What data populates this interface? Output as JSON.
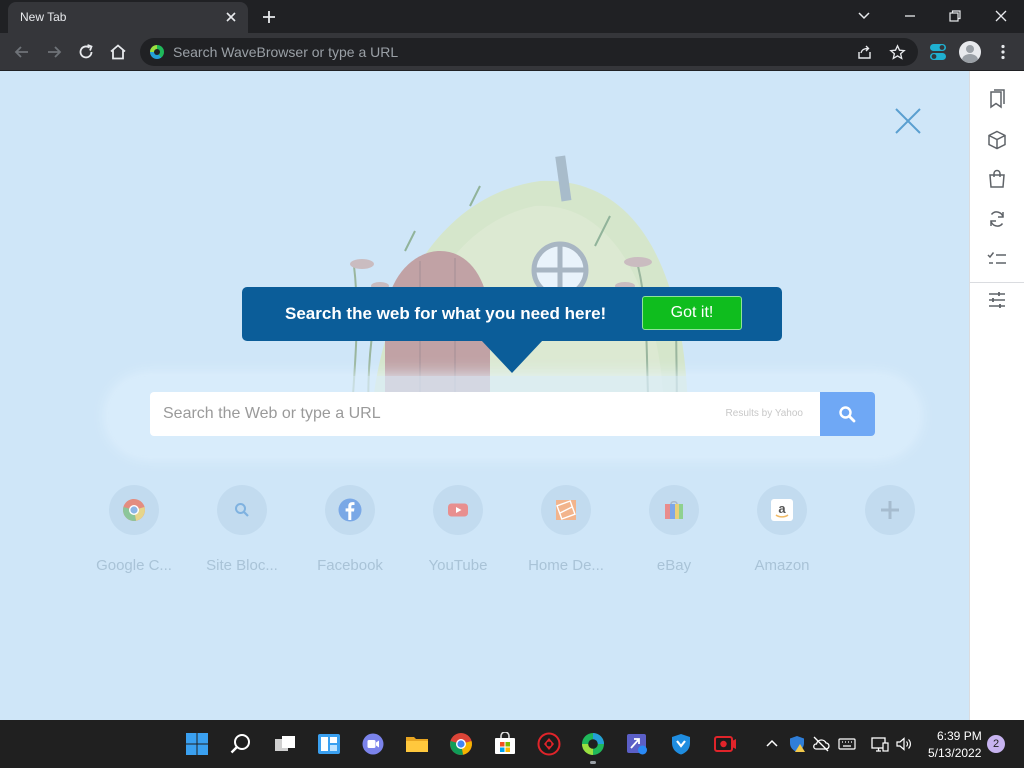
{
  "tab": {
    "title": "New Tab"
  },
  "omnibox": {
    "placeholder": "Search WaveBrowser or type a URL"
  },
  "tooltip": {
    "text": "Search the web for what you need here!",
    "button": "Got it!"
  },
  "search": {
    "placeholder": "Search the Web or type a URL",
    "provider": "Results by Yahoo"
  },
  "tiles": [
    {
      "label": "Google C...",
      "icon": "chrome-icon"
    },
    {
      "label": "Site Bloc...",
      "icon": "search-icon"
    },
    {
      "label": "Facebook",
      "icon": "facebook-icon"
    },
    {
      "label": "YouTube",
      "icon": "youtube-icon"
    },
    {
      "label": "Home De...",
      "icon": "home-depot-icon"
    },
    {
      "label": "eBay",
      "icon": "ebay-icon"
    },
    {
      "label": "Amazon",
      "icon": "amazon-icon"
    },
    {
      "label": "",
      "icon": "add-icon"
    }
  ],
  "taskbar": {
    "time": "6:39 PM",
    "date": "5/13/2022",
    "notifications": "2"
  },
  "colors": {
    "accent": "#0b5d99",
    "gotit": "#0fbd1e",
    "search_button": "#6fa8f5",
    "background": "#cfe6f8"
  }
}
